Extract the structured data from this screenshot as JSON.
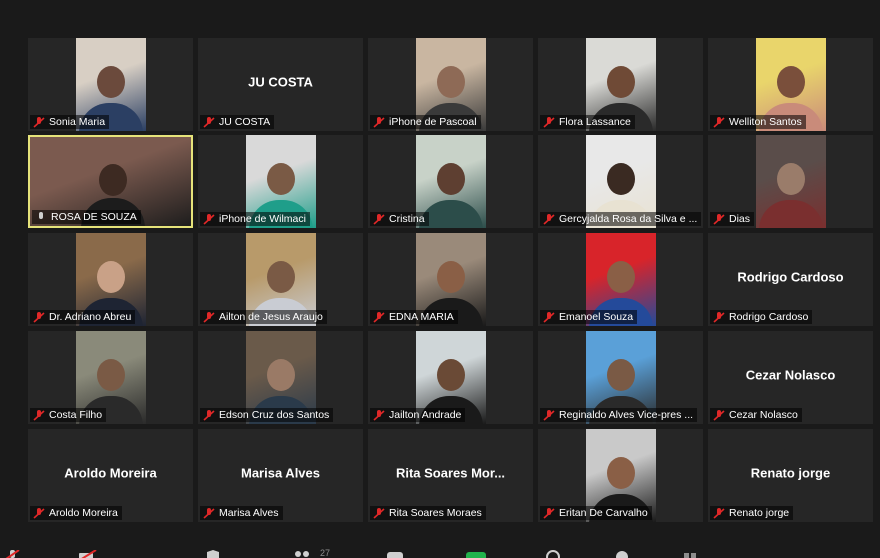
{
  "meeting": {
    "participants": [
      {
        "name": "Sonia Maria",
        "display": "",
        "video": true,
        "muted": true,
        "colors": [
          "#d8cfc4",
          "#6b4a3c",
          "#2b3f63"
        ]
      },
      {
        "name": "JU COSTA",
        "display": "JU COSTA",
        "video": false,
        "muted": true
      },
      {
        "name": "iPhone de Pascoal",
        "display": "",
        "video": true,
        "muted": true,
        "colors": [
          "#c9b6a1",
          "#8e6a56",
          "#3a3a3a"
        ]
      },
      {
        "name": "Flora Lassance",
        "display": "",
        "video": true,
        "muted": true,
        "colors": [
          "#dadad6",
          "#6f4a36",
          "#2a2a2a"
        ]
      },
      {
        "name": "Welliton Santos",
        "display": "",
        "video": true,
        "muted": true,
        "colors": [
          "#e9d56b",
          "#7a4f3b",
          "#c98b7a"
        ]
      },
      {
        "name": "ROSA DE SOUZA",
        "display": "",
        "video": true,
        "muted": false,
        "active": true,
        "colors": [
          "#7b5a4f",
          "#3d2a22",
          "#1c1c1c"
        ]
      },
      {
        "name": "iPhone de Wilmaci",
        "display": "",
        "video": true,
        "muted": true,
        "colors": [
          "#d9d9d9",
          "#7a5a45",
          "#1f9e8a"
        ]
      },
      {
        "name": "Cristina",
        "display": "",
        "video": true,
        "muted": true,
        "colors": [
          "#c8d2c8",
          "#5e3f31",
          "#2c4d4a"
        ]
      },
      {
        "name": "Gercyjalda Rosa da Silva e ...",
        "display": "",
        "video": true,
        "muted": true,
        "colors": [
          "#e8e8e8",
          "#3a2a22",
          "#e8e2d2"
        ]
      },
      {
        "name": "Dias",
        "display": "",
        "video": true,
        "muted": true,
        "colors": [
          "#5a4d4a",
          "#9a7c6a",
          "#7a2f2f"
        ]
      },
      {
        "name": "Dr. Adriano Abreu",
        "display": "",
        "video": true,
        "muted": true,
        "colors": [
          "#8a6a4a",
          "#c9a187",
          "#1e2433"
        ]
      },
      {
        "name": "Ailton de Jesus Araujo",
        "display": "",
        "video": true,
        "muted": true,
        "colors": [
          "#b89a6a",
          "#7a5a45",
          "#c9ccd3"
        ]
      },
      {
        "name": "EDNA MARIA",
        "display": "",
        "video": true,
        "muted": true,
        "colors": [
          "#9a8a7a",
          "#8a5f46",
          "#1a1a1a"
        ]
      },
      {
        "name": "Emanoel Souza",
        "display": "",
        "video": true,
        "muted": true,
        "colors": [
          "#d8242a",
          "#8a5f46",
          "#244a9a"
        ]
      },
      {
        "name": "Rodrigo Cardoso",
        "display": "Rodrigo Cardoso",
        "video": false,
        "muted": true
      },
      {
        "name": "Costa Filho",
        "display": "",
        "video": true,
        "muted": true,
        "colors": [
          "#8a8a7a",
          "#7a5a45",
          "#2a2a2a"
        ]
      },
      {
        "name": "Edson Cruz dos Santos",
        "display": "",
        "video": true,
        "muted": true,
        "colors": [
          "#6a5a4a",
          "#9a7a66",
          "#2a3a4a"
        ]
      },
      {
        "name": "Jailton Andrade",
        "display": "",
        "video": true,
        "muted": true,
        "colors": [
          "#cfd6d8",
          "#6a4a36",
          "#1a1a1a"
        ]
      },
      {
        "name": "Reginaldo Alves Vice-pres ...",
        "display": "",
        "video": true,
        "muted": true,
        "colors": [
          "#5aa0d8",
          "#7a5a45",
          "#2a2a2a"
        ]
      },
      {
        "name": "Cezar Nolasco",
        "display": "Cezar Nolasco",
        "video": false,
        "muted": true
      },
      {
        "name": "Aroldo Moreira",
        "display": "Aroldo Moreira",
        "video": false,
        "muted": true
      },
      {
        "name": "Marisa Alves",
        "display": "Marisa Alves",
        "video": false,
        "muted": true
      },
      {
        "name": "Rita Soares Moraes",
        "display": "Rita Soares Mor...",
        "video": false,
        "muted": true
      },
      {
        "name": "Eritan De Carvalho",
        "display": "",
        "video": true,
        "muted": true,
        "colors": [
          "#c9c9c9",
          "#8a5f46",
          "#1a1a1a"
        ]
      },
      {
        "name": "Renato jorge",
        "display": "Renato jorge",
        "video": false,
        "muted": true
      }
    ]
  },
  "toolbar": {
    "participants_count": "27"
  },
  "colors": {
    "tile_bg": "#262626",
    "active_border": "#e6e37a",
    "muted_icon": "#e02828",
    "background": "#1a1a1a"
  }
}
